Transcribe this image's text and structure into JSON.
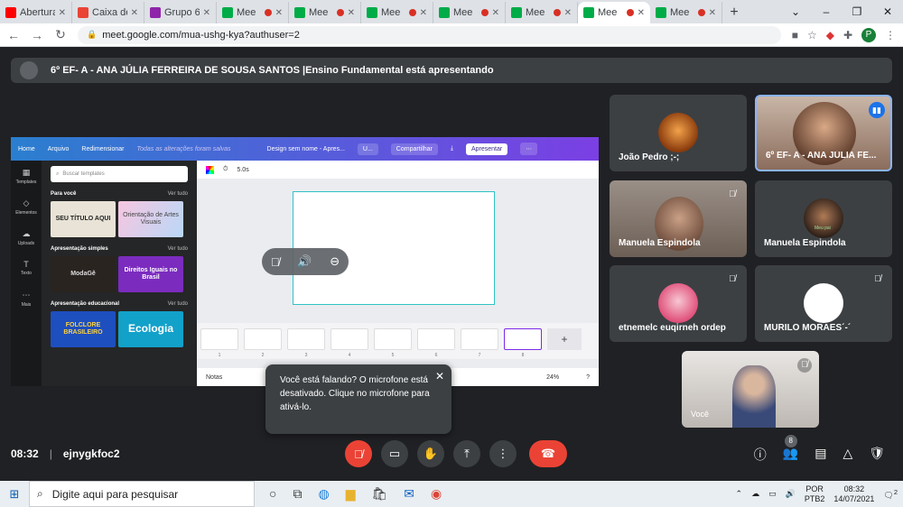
{
  "browser": {
    "tabs": [
      {
        "label": "Abertura",
        "favicon_color": "#ff0000"
      },
      {
        "label": "Caixa de",
        "favicon_color": "#ea4335"
      },
      {
        "label": "Grupo 6",
        "favicon_color": "#8e24aa"
      },
      {
        "label": "Mee",
        "favicon_color": "#00ac47",
        "recording": true
      },
      {
        "label": "Mee",
        "favicon_color": "#00ac47",
        "recording": true
      },
      {
        "label": "Mee",
        "favicon_color": "#00ac47",
        "recording": true
      },
      {
        "label": "Mee",
        "favicon_color": "#00ac47",
        "recording": true
      },
      {
        "label": "Mee",
        "favicon_color": "#00ac47",
        "recording": true
      },
      {
        "label": "Mee",
        "favicon_color": "#00ac47",
        "recording": true,
        "active": true
      },
      {
        "label": "Mee",
        "favicon_color": "#00ac47",
        "recording": true
      }
    ],
    "url": "meet.google.com/mua-ushg-kya?authuser=2",
    "profile_initial": "P"
  },
  "presenting_banner": "6º EF- A - ANA JÚLIA FERREIRA DE SOUSA SANTOS |Ensino Fundamental está apresentando",
  "canva": {
    "top": {
      "home": "Home",
      "file": "Arquivo",
      "resize": "Redimensionar",
      "saved": "Todas as alterações foram salvas",
      "design_name": "Design sem nome - Apres...",
      "upgrade": "U...",
      "share": "Compartilhar",
      "present": "Apresentar"
    },
    "rail": [
      "Templates",
      "Elementos",
      "Uploads",
      "Texto",
      "Mais"
    ],
    "search_placeholder": "Buscar templates",
    "sections": [
      {
        "title": "Para você",
        "see_all": "Ver tudo",
        "thumbs": [
          "SEU TÍTULO AQUI",
          "Orientação de Artes Visuais"
        ]
      },
      {
        "title": "Apresentação simples",
        "see_all": "Ver tudo",
        "thumbs": [
          "ModaGê",
          "Direitos Iguais no Brasil"
        ]
      },
      {
        "title": "Apresentação educacional",
        "see_all": "Ver tudo",
        "thumbs": [
          "FOLCLORE BRASILEIRO",
          "Ecologia"
        ]
      }
    ],
    "timer": "5.0s",
    "pages": [
      "1",
      "2",
      "3",
      "4",
      "5",
      "6",
      "7",
      "8"
    ],
    "notes": "Notas",
    "zoom": "24%"
  },
  "participants": [
    {
      "name": "João Pedro ;-;"
    },
    {
      "name": "6º EF- A - ANA JÚLIA FE..."
    },
    {
      "name": "Manuela Espindola"
    },
    {
      "name": "Manuela Espindola",
      "tag": "Meu pai"
    },
    {
      "name": "etnemelc euqirneh ordep"
    },
    {
      "name": "MURILO MORAES´-´"
    },
    {
      "name": "Você"
    }
  ],
  "tooltip": "Você está falando? O microfone está desativado. Clique no microfone para ativá-lo.",
  "meeting": {
    "time": "08:32",
    "code": "ejnygkfoc2",
    "people_count": "8"
  },
  "taskbar": {
    "search_placeholder": "Digite aqui para pesquisar",
    "lang": "POR",
    "lang2": "PTB2",
    "time": "08:32",
    "date": "14/07/2021",
    "notif_count": "2"
  }
}
